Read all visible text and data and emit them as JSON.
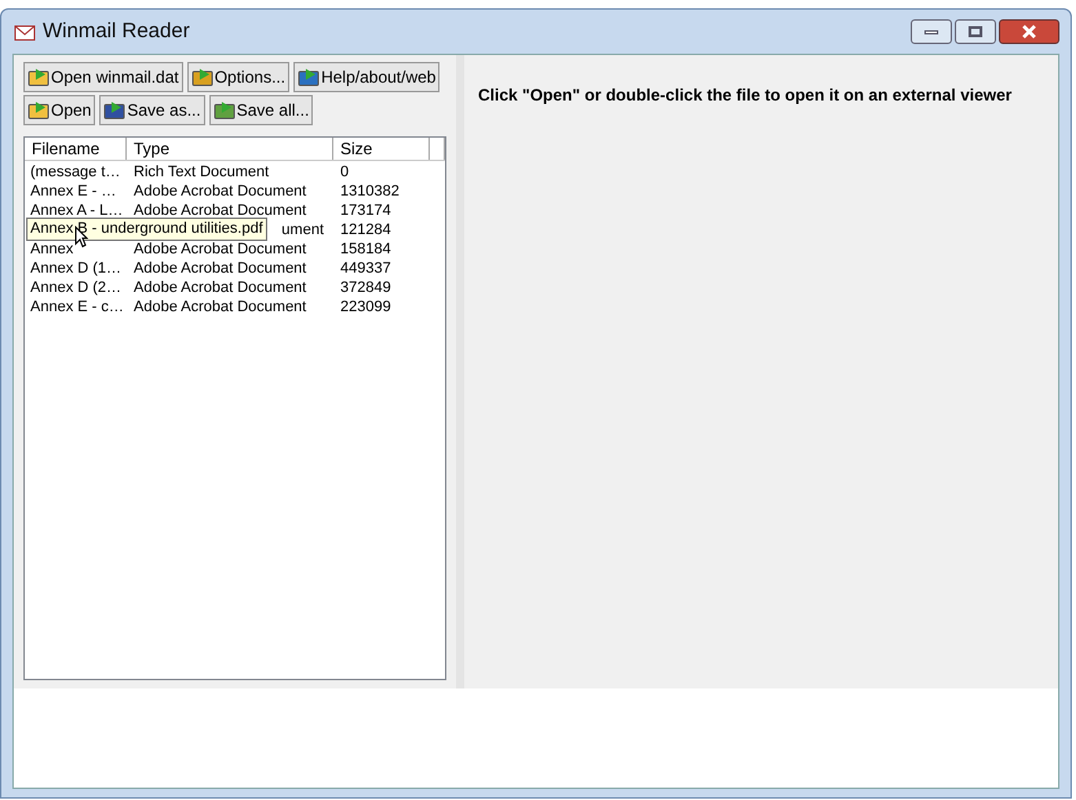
{
  "window": {
    "title": "Winmail Reader"
  },
  "toolbar_rows": [
    [
      "Open winmail.dat",
      "Options...",
      "Help/about/web"
    ],
    [
      "Open",
      "Save as...",
      "Save all..."
    ]
  ],
  "table": {
    "columns": [
      "Filename",
      "Type",
      "Size"
    ],
    "rows": [
      {
        "filename": "(message t…",
        "type": "Rich Text Document",
        "size": "0"
      },
      {
        "filename": "Annex E - …",
        "type": "Adobe Acrobat Document",
        "size": "1310382"
      },
      {
        "filename": "Annex A - L…",
        "type": "Adobe Acrobat Document",
        "size": "173174"
      },
      {
        "type": "ument",
        "size": "121284",
        "tooltip": "Annex B - underground utilities.pdf"
      },
      {
        "filename": "Annex",
        "type": "Adobe Acrobat Document",
        "size": "158184"
      },
      {
        "filename": "Annex D (1…",
        "type": "Adobe Acrobat Document",
        "size": "449337"
      },
      {
        "filename": "Annex D (2…",
        "type": "Adobe Acrobat Document",
        "size": "372849"
      },
      {
        "filename": "Annex E - c…",
        "type": "Adobe Acrobat Document",
        "size": "223099"
      }
    ]
  },
  "viewer": {
    "hint": "Click \"Open\" or double-click the file to open it on an external viewer"
  }
}
